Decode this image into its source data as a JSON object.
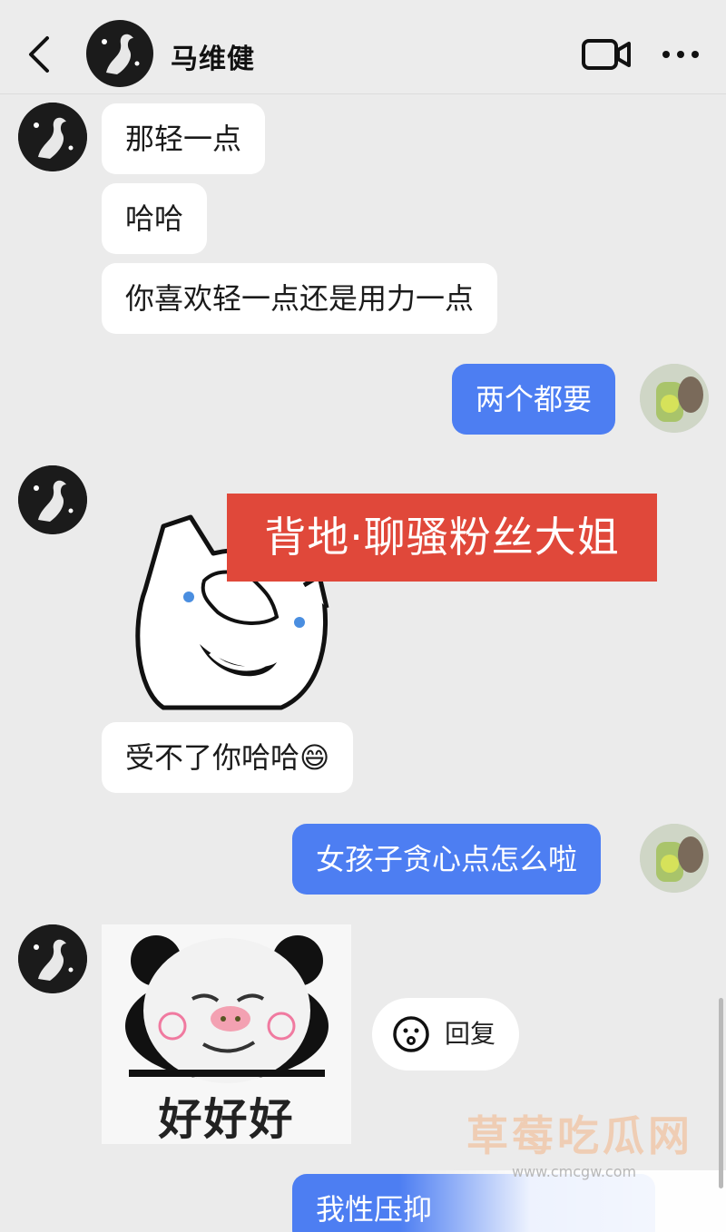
{
  "header": {
    "contact_name": "马维健",
    "back_icon": "chevron-left-icon",
    "video_icon": "video-camera-icon",
    "more_icon": "more-dots-icon"
  },
  "messages": [
    {
      "side": "in",
      "text": "那轻一点"
    },
    {
      "side": "in",
      "text": "哈哈"
    },
    {
      "side": "in",
      "text": "你喜欢轻一点还是用力一点"
    },
    {
      "side": "out",
      "text": "两个都要"
    },
    {
      "side": "in",
      "sticker": "cat-covering-face-sticker",
      "banner": "背地·聊骚粉丝大姐"
    },
    {
      "side": "in",
      "text": "受不了你哈哈",
      "emoji": "😄"
    },
    {
      "side": "out",
      "text": "女孩子贪心点怎么啦"
    },
    {
      "side": "in",
      "sticker": "panda-meme-sticker",
      "caption": "好好好"
    },
    {
      "side": "out",
      "text": "我性压抑"
    }
  ],
  "reply_pill": {
    "label": "回复",
    "icon": "smiley-icon"
  },
  "watermark": {
    "title": "草莓吃瓜网",
    "url": "www.cmcgw.com"
  },
  "colors": {
    "background": "#ebebeb",
    "incoming_bubble": "#ffffff",
    "outgoing_bubble": "#4d7ef2",
    "banner_red": "#e0483a"
  }
}
